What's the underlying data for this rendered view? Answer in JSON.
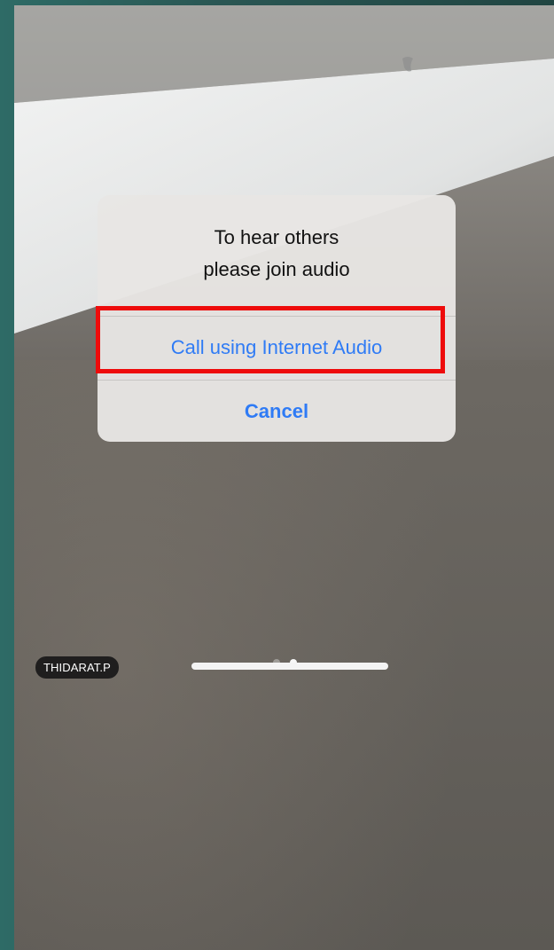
{
  "dialog": {
    "title_line1": "To hear others",
    "title_line2": "please join audio",
    "primary_action": "Call using Internet Audio",
    "cancel_action": "Cancel"
  },
  "participant": {
    "name": "THIDARAT.P"
  },
  "pager": {
    "page_count": 2,
    "active_page": 2
  },
  "colors": {
    "link_blue": "#2f7bf5",
    "highlight_red": "#ee0b0b",
    "dialog_bg": "#e8e6e4",
    "frame_teal": "#2e6b66"
  }
}
